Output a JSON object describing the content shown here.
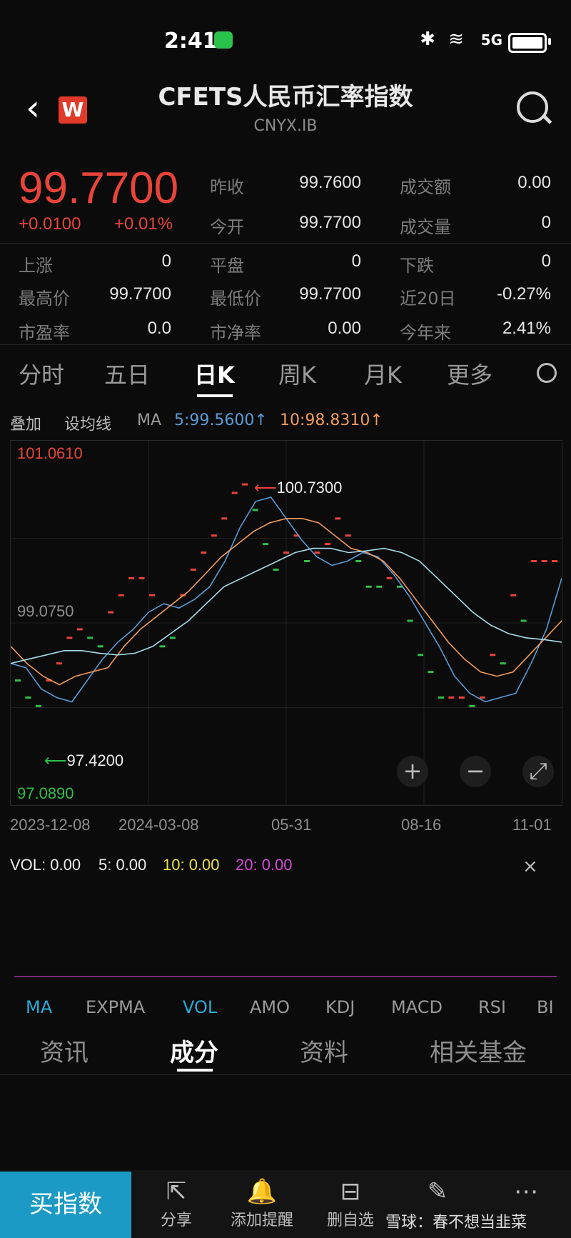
{
  "status": {
    "time": "2:41",
    "network": "5G"
  },
  "header": {
    "logo_letter": "W",
    "title": "CFETS人民币汇率指数",
    "subtitle": "CNYX.IB"
  },
  "quote": {
    "price": "99.7700",
    "change": "+0.0100",
    "change_pct": "+0.01%",
    "stats": [
      {
        "label": "昨收",
        "value": "99.7600"
      },
      {
        "label": "成交额",
        "value": "0.00"
      },
      {
        "label": "今开",
        "value": "99.7700"
      },
      {
        "label": "成交量",
        "value": "0"
      },
      {
        "label": "上涨",
        "value": "0"
      },
      {
        "label": "平盘",
        "value": "0"
      },
      {
        "label": "下跌",
        "value": "0"
      },
      {
        "label": "最高价",
        "value": "99.7700"
      },
      {
        "label": "最低价",
        "value": "99.7700"
      },
      {
        "label": "近20日",
        "value": "-0.27%"
      },
      {
        "label": "市盈率",
        "value": "0.0"
      },
      {
        "label": "市净率",
        "value": "0.00"
      },
      {
        "label": "今年来",
        "value": "2.41%"
      }
    ]
  },
  "tabs": [
    "分时",
    "五日",
    "日K",
    "周K",
    "月K",
    "更多"
  ],
  "ma_row": {
    "overlay": "叠加",
    "set_ma": "设均线",
    "ma": "MA",
    "ma5": "5:99.5600↑",
    "ma10": "10:98.8310↑"
  },
  "colors": {
    "up": "#e8443a",
    "down": "#2fbf4a",
    "ma5": "#5b9bd5",
    "ma10": "#f39b5a",
    "ma20": "#a6dce8",
    "accent": "#1b9ac5"
  },
  "chart_data": {
    "type": "line",
    "ylim": [
      97.089,
      101.061
    ],
    "y_top_label": "101.0610",
    "y_mid_label": "99.0750",
    "y_bottom_label": "97.0890",
    "high_marker": "100.7300",
    "low_marker": "97.4200",
    "x_tick_labels": [
      "2023-12-08",
      "2024-03-08",
      "05-31",
      "08-16",
      "11-01"
    ],
    "candles": [
      {
        "v": 98.4,
        "d": "down"
      },
      {
        "v": 98.2,
        "d": "down"
      },
      {
        "v": 98.1,
        "d": "down"
      },
      {
        "v": 98.4,
        "d": "up"
      },
      {
        "v": 98.6,
        "d": "up"
      },
      {
        "v": 98.9,
        "d": "up"
      },
      {
        "v": 99.0,
        "d": "up"
      },
      {
        "v": 98.9,
        "d": "down"
      },
      {
        "v": 98.8,
        "d": "down"
      },
      {
        "v": 99.2,
        "d": "up"
      },
      {
        "v": 99.4,
        "d": "up"
      },
      {
        "v": 99.6,
        "d": "up"
      },
      {
        "v": 99.6,
        "d": "up"
      },
      {
        "v": 99.4,
        "d": "up"
      },
      {
        "v": 98.8,
        "d": "down"
      },
      {
        "v": 98.9,
        "d": "down"
      },
      {
        "v": 99.4,
        "d": "up"
      },
      {
        "v": 99.7,
        "d": "up"
      },
      {
        "v": 99.9,
        "d": "up"
      },
      {
        "v": 100.1,
        "d": "up"
      },
      {
        "v": 100.3,
        "d": "up"
      },
      {
        "v": 100.6,
        "d": "up"
      },
      {
        "v": 100.7,
        "d": "up"
      },
      {
        "v": 100.4,
        "d": "down"
      },
      {
        "v": 100.0,
        "d": "down"
      },
      {
        "v": 99.7,
        "d": "down"
      },
      {
        "v": 99.9,
        "d": "up"
      },
      {
        "v": 100.1,
        "d": "up"
      },
      {
        "v": 99.8,
        "d": "down"
      },
      {
        "v": 99.9,
        "d": "up"
      },
      {
        "v": 100.0,
        "d": "up"
      },
      {
        "v": 100.3,
        "d": "up"
      },
      {
        "v": 100.1,
        "d": "up"
      },
      {
        "v": 99.8,
        "d": "down"
      },
      {
        "v": 99.5,
        "d": "down"
      },
      {
        "v": 99.5,
        "d": "down"
      },
      {
        "v": 99.6,
        "d": "up"
      },
      {
        "v": 99.5,
        "d": "down"
      },
      {
        "v": 99.1,
        "d": "down"
      },
      {
        "v": 98.7,
        "d": "down"
      },
      {
        "v": 98.5,
        "d": "down"
      },
      {
        "v": 98.2,
        "d": "down"
      },
      {
        "v": 98.2,
        "d": "up"
      },
      {
        "v": 98.2,
        "d": "up"
      },
      {
        "v": 98.1,
        "d": "down"
      },
      {
        "v": 98.2,
        "d": "up"
      },
      {
        "v": 98.7,
        "d": "up"
      },
      {
        "v": 98.6,
        "d": "down"
      },
      {
        "v": 99.4,
        "d": "up"
      },
      {
        "v": 99.1,
        "d": "down"
      },
      {
        "v": 99.8,
        "d": "up"
      },
      {
        "v": 99.8,
        "d": "up"
      },
      {
        "v": 99.8,
        "d": "up"
      }
    ],
    "series": [
      {
        "key": "ma5",
        "values": [
          98.6,
          98.55,
          98.3,
          98.2,
          98.15,
          98.4,
          98.65,
          98.85,
          99.0,
          99.2,
          99.3,
          99.25,
          99.35,
          99.5,
          99.8,
          100.2,
          100.5,
          100.55,
          100.3,
          100.05,
          99.85,
          99.75,
          99.8,
          99.9,
          99.85,
          99.65,
          99.4,
          99.1,
          98.8,
          98.45,
          98.25,
          98.15,
          98.2,
          98.25,
          98.6,
          99.0,
          99.6
        ]
      },
      {
        "key": "ma10",
        "values": [
          98.8,
          98.6,
          98.45,
          98.35,
          98.45,
          98.5,
          98.55,
          98.8,
          99.0,
          99.15,
          99.3,
          99.45,
          99.65,
          99.85,
          100.0,
          100.15,
          100.25,
          100.3,
          100.3,
          100.25,
          100.1,
          99.95,
          99.9,
          99.8,
          99.6,
          99.35,
          99.1,
          98.85,
          98.65,
          98.5,
          98.45,
          98.5,
          98.7,
          98.9,
          99.1
        ]
      },
      {
        "key": "ma20",
        "values": [
          98.6,
          98.65,
          98.7,
          98.75,
          98.75,
          98.72,
          98.7,
          98.72,
          98.8,
          98.95,
          99.1,
          99.3,
          99.5,
          99.6,
          99.7,
          99.8,
          99.9,
          99.95,
          99.95,
          99.9,
          99.92,
          99.95,
          99.9,
          99.8,
          99.6,
          99.4,
          99.2,
          99.05,
          98.95,
          98.9,
          98.88,
          98.85
        ]
      }
    ]
  },
  "zoom": {
    "plus": "+",
    "minus": "−",
    "expand": "⤢"
  },
  "volume": {
    "vol": "VOL: 0.00",
    "v5": "5: 0.00",
    "v10": "10: 0.00",
    "v20": "20: 0.00",
    "close": "×"
  },
  "indicators": [
    "MA",
    "EXPMA",
    "VOL",
    "AMO",
    "KDJ",
    "MACD",
    "RSI",
    "BI"
  ],
  "sections": [
    "资讯",
    "成分",
    "资料",
    "相关基金"
  ],
  "bottom": {
    "buy": "买指数",
    "items": [
      {
        "label": "分享",
        "icon": "⇱"
      },
      {
        "label": "添加提醒",
        "icon": "🔔"
      },
      {
        "label": "删自选",
        "icon": "⊟"
      },
      {
        "label": "",
        "icon": "✎"
      },
      {
        "label": "",
        "icon": "⋯"
      }
    ],
    "watermark": "雪球：春不想当韭菜"
  }
}
